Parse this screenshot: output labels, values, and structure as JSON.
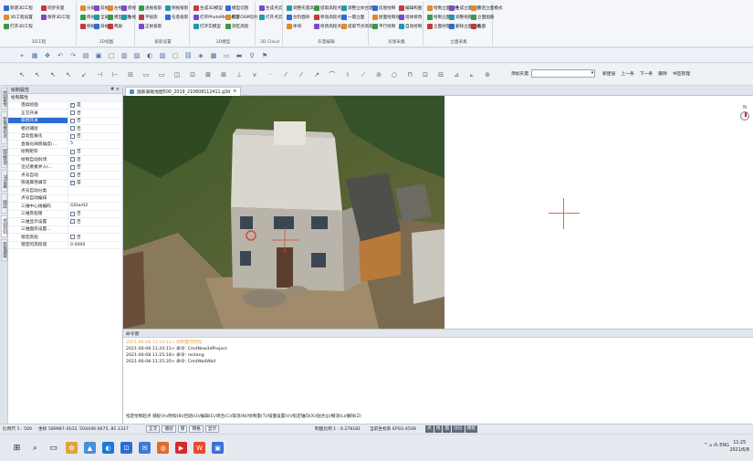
{
  "ribbon": {
    "groups": [
      {
        "title": "3D工程",
        "items": [
          "新建3D工程",
          "3D工程设置",
          "打开3D工程",
          "同步矢量",
          "保存3D工程"
        ]
      },
      {
        "title": "3D视图",
        "items": [
          "分屏",
          "俯视",
          "侧视",
          "前视",
          "全屏",
          "斜视",
          "左视",
          "模型显示",
          "两屏",
          "俯视",
          "右视"
        ]
      },
      {
        "title": "投影设置",
        "items": [
          "透视投影",
          "平投影",
          "正射投影",
          "侧视投影",
          "任意投影"
        ]
      },
      {
        "title": "3D模型",
        "items": [
          "生成3D模型",
          "打开PhotoMesh模型",
          "打开实模型",
          "模型切割",
          "打开OSM切片",
          "测区高程"
        ]
      },
      {
        "title": "3D Cloud",
        "items": [
          "生成点云",
          "打开点云"
        ]
      },
      {
        "title": "矢量编辑",
        "items": [
          "调整矢量高程",
          "台阶面块",
          "体块",
          "提取高程点",
          "移动高程点",
          "修改高程点",
          "调整立体台建",
          "一键立面",
          "提取节点高程"
        ]
      },
      {
        "title": "房屋采集",
        "items": [
          "房屋绘制",
          "屋面绘制效果",
          "平行绘制",
          "编辑构图",
          "墙体修改",
          "自动绘制"
        ]
      },
      {
        "title": "立面采集",
        "items": [
          "绘制立面图线",
          "绘制立面线",
          "立面纹理",
          "生成立面图纸",
          "调整视频",
          "删除立面图纸",
          "开启立面模式",
          "立面图册",
          "截图"
        ]
      }
    ]
  },
  "toolbar1": {
    "icons": [
      "cursor-icon",
      "grid-icon",
      "pan-icon",
      "undo-icon",
      "redo-icon",
      "layers-icon",
      "save-icon",
      "window-icon",
      "table-icon",
      "image-icon",
      "color-icon",
      "chart-icon",
      "paste-icon",
      "link-icon",
      "3d-icon",
      "layer-icon",
      "box-icon",
      "line-icon",
      "filter-icon",
      "tag-icon"
    ]
  },
  "toolbar2": {
    "layer_label": "添加矢量",
    "actions": [
      "新建层",
      "上一条",
      "下一条",
      "删除",
      "书签管理"
    ]
  },
  "vertical_tabs": [
    "绘制属性",
    "影像/像控点",
    "图层管理",
    "3D设置",
    "图层",
    "绘制控制",
    "影像编辑"
  ],
  "property_panel": {
    "title": "绘制属性",
    "pin": "# ×",
    "section": "绘制属性",
    "rows": [
      {
        "key": "连续绘图",
        "checked": true,
        "value": "是"
      },
      {
        "key": "正交开关",
        "checked": false,
        "value": "否"
      },
      {
        "key": "吸附开关",
        "checked": false,
        "value": "否",
        "selected": true
      },
      {
        "key": "相对捕捉",
        "checked": false,
        "value": "否"
      },
      {
        "key": "自动直角化",
        "checked": false,
        "value": "否"
      },
      {
        "key": "直角化阈值角度(...",
        "checked": null,
        "value": "5"
      },
      {
        "key": "绘制矩形",
        "checked": false,
        "value": "否"
      },
      {
        "key": "绘制自动封闭",
        "checked": false,
        "value": "否"
      },
      {
        "key": "注记要素并入(...",
        "checked": false,
        "value": "否"
      },
      {
        "key": "点号自动",
        "checked": false,
        "value": "否"
      },
      {
        "key": "快速属性填写",
        "checked": true,
        "value": "是"
      },
      {
        "key": "点号自动分类",
        "checked": null,
        "value": ""
      },
      {
        "key": "点号自动编排",
        "checked": null,
        "value": ""
      },
      {
        "key": "三维中心线编码",
        "checked": null,
        "value": "GStar02"
      },
      {
        "key": "三维高程锁",
        "checked": false,
        "value": "否"
      },
      {
        "key": "三维显示设置",
        "checked": false,
        "value": "否"
      },
      {
        "key": "三维面形设置...",
        "checked": null,
        "value": ""
      },
      {
        "key": "锁定高程",
        "checked": false,
        "value": "否"
      },
      {
        "key": "锁定的高程值",
        "checked": null,
        "value": "0.0000"
      }
    ]
  },
  "document_tab": {
    "label": "国家基础地图500_2019_210608112411.g3d",
    "close": "×"
  },
  "command_panel": {
    "title": "命令窗",
    "lines": [
      {
        "text": "2021-06-08 11:24:11> 绘制置顶历程",
        "color": "#e8a13a"
      },
      {
        "text": "2021-06-08 11:24:11> 命令: CmdNew3dProject",
        "color": "#222"
      },
      {
        "text": "2021-06-08 11:25:18> 命令: rectang",
        "color": "#222"
      },
      {
        "text": "2021-06-08 11:25:20> 命令: CmdWallWall",
        "color": "#222"
      }
    ],
    "prompt": "指定绘制起点 捕捉(A)/附假(B)/回退(U)/编辑(E)/闭合(C)/取消(N)/绘制量(T)/墙面设置(V)/指定轴向(X)/贴合(J)/撤消(L)/删除(Z)"
  },
  "status_bar": {
    "scale": "比例尺 1 : 500",
    "coords": "坐标 589987.4102, 504446.0675, 81.1317",
    "buttons": [
      "正交",
      "捕捉",
      "锁",
      "网格",
      "显示"
    ],
    "ratio": "制图比例 1 : 0.278181",
    "crs": "当前坐标系 EPSG:4508",
    "snap_tags": [
      "点",
      "线",
      "面",
      "注记",
      "捕捉"
    ]
  },
  "taskbar": {
    "icons": [
      "windows-icon",
      "search-icon",
      "task-view-icon",
      "app1-icon",
      "app2-icon",
      "edge-icon",
      "store-icon",
      "mail-icon",
      "firefox-icon",
      "media-icon",
      "office-icon",
      "app3-icon"
    ],
    "tray": "^ ⌂ ⁂ ENG",
    "time": "11:25",
    "date": "2021/6/8"
  },
  "viewport": {
    "north_label": "N",
    "cross_color": "#d86a5a"
  },
  "colors": {
    "accent": "#1b5ec9",
    "ribbon_bg": "#f4f6f9",
    "panel_select": "#2d6bd6"
  }
}
